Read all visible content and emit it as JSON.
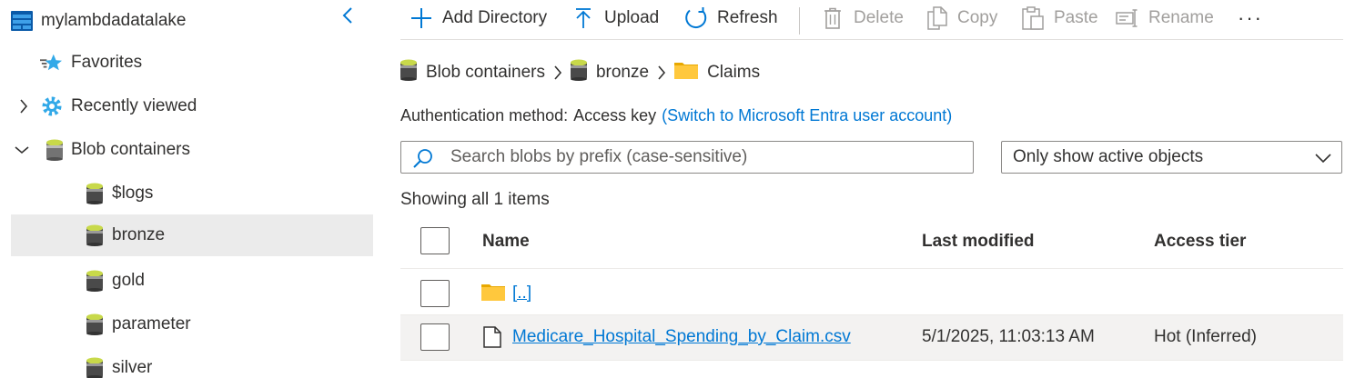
{
  "sidebar": {
    "account_name": "mylambdadatalake",
    "items": [
      {
        "label": "Favorites"
      },
      {
        "label": "Recently viewed"
      },
      {
        "label": "Blob containers"
      },
      {
        "label": "$logs"
      },
      {
        "label": "bronze"
      },
      {
        "label": "gold"
      },
      {
        "label": "parameter"
      },
      {
        "label": "silver"
      }
    ],
    "selected": "bronze"
  },
  "toolbar": {
    "add_directory": "Add Directory",
    "upload": "Upload",
    "refresh": "Refresh",
    "delete": "Delete",
    "copy": "Copy",
    "paste": "Paste",
    "rename": "Rename",
    "more": "···"
  },
  "breadcrumb": [
    "Blob containers",
    "bronze",
    "Claims"
  ],
  "auth": {
    "label": "Authentication method:",
    "value": "Access key",
    "switch_link": "(Switch to Microsoft Entra user account)"
  },
  "search": {
    "placeholder": "Search blobs by prefix (case-sensitive)",
    "value": ""
  },
  "filter": {
    "selected": "Only show active objects"
  },
  "showing_text": "Showing all 1 items",
  "table": {
    "columns": {
      "name": "Name",
      "last_modified": "Last modified",
      "access_tier": "Access tier"
    },
    "rows": [
      {
        "name": "[..]",
        "last_modified": "",
        "access_tier": "",
        "type": "folder"
      },
      {
        "name": "Medicare_Hospital_Spending_by_Claim.csv",
        "last_modified": "5/1/2025, 11:03:13 AM",
        "access_tier": "Hot (Inferred)",
        "type": "file"
      }
    ]
  },
  "colors": {
    "accent": "#0078d4",
    "folder": "#ffc83d",
    "selected_bg": "#ebebeb",
    "disabled": "#a19f9d"
  }
}
